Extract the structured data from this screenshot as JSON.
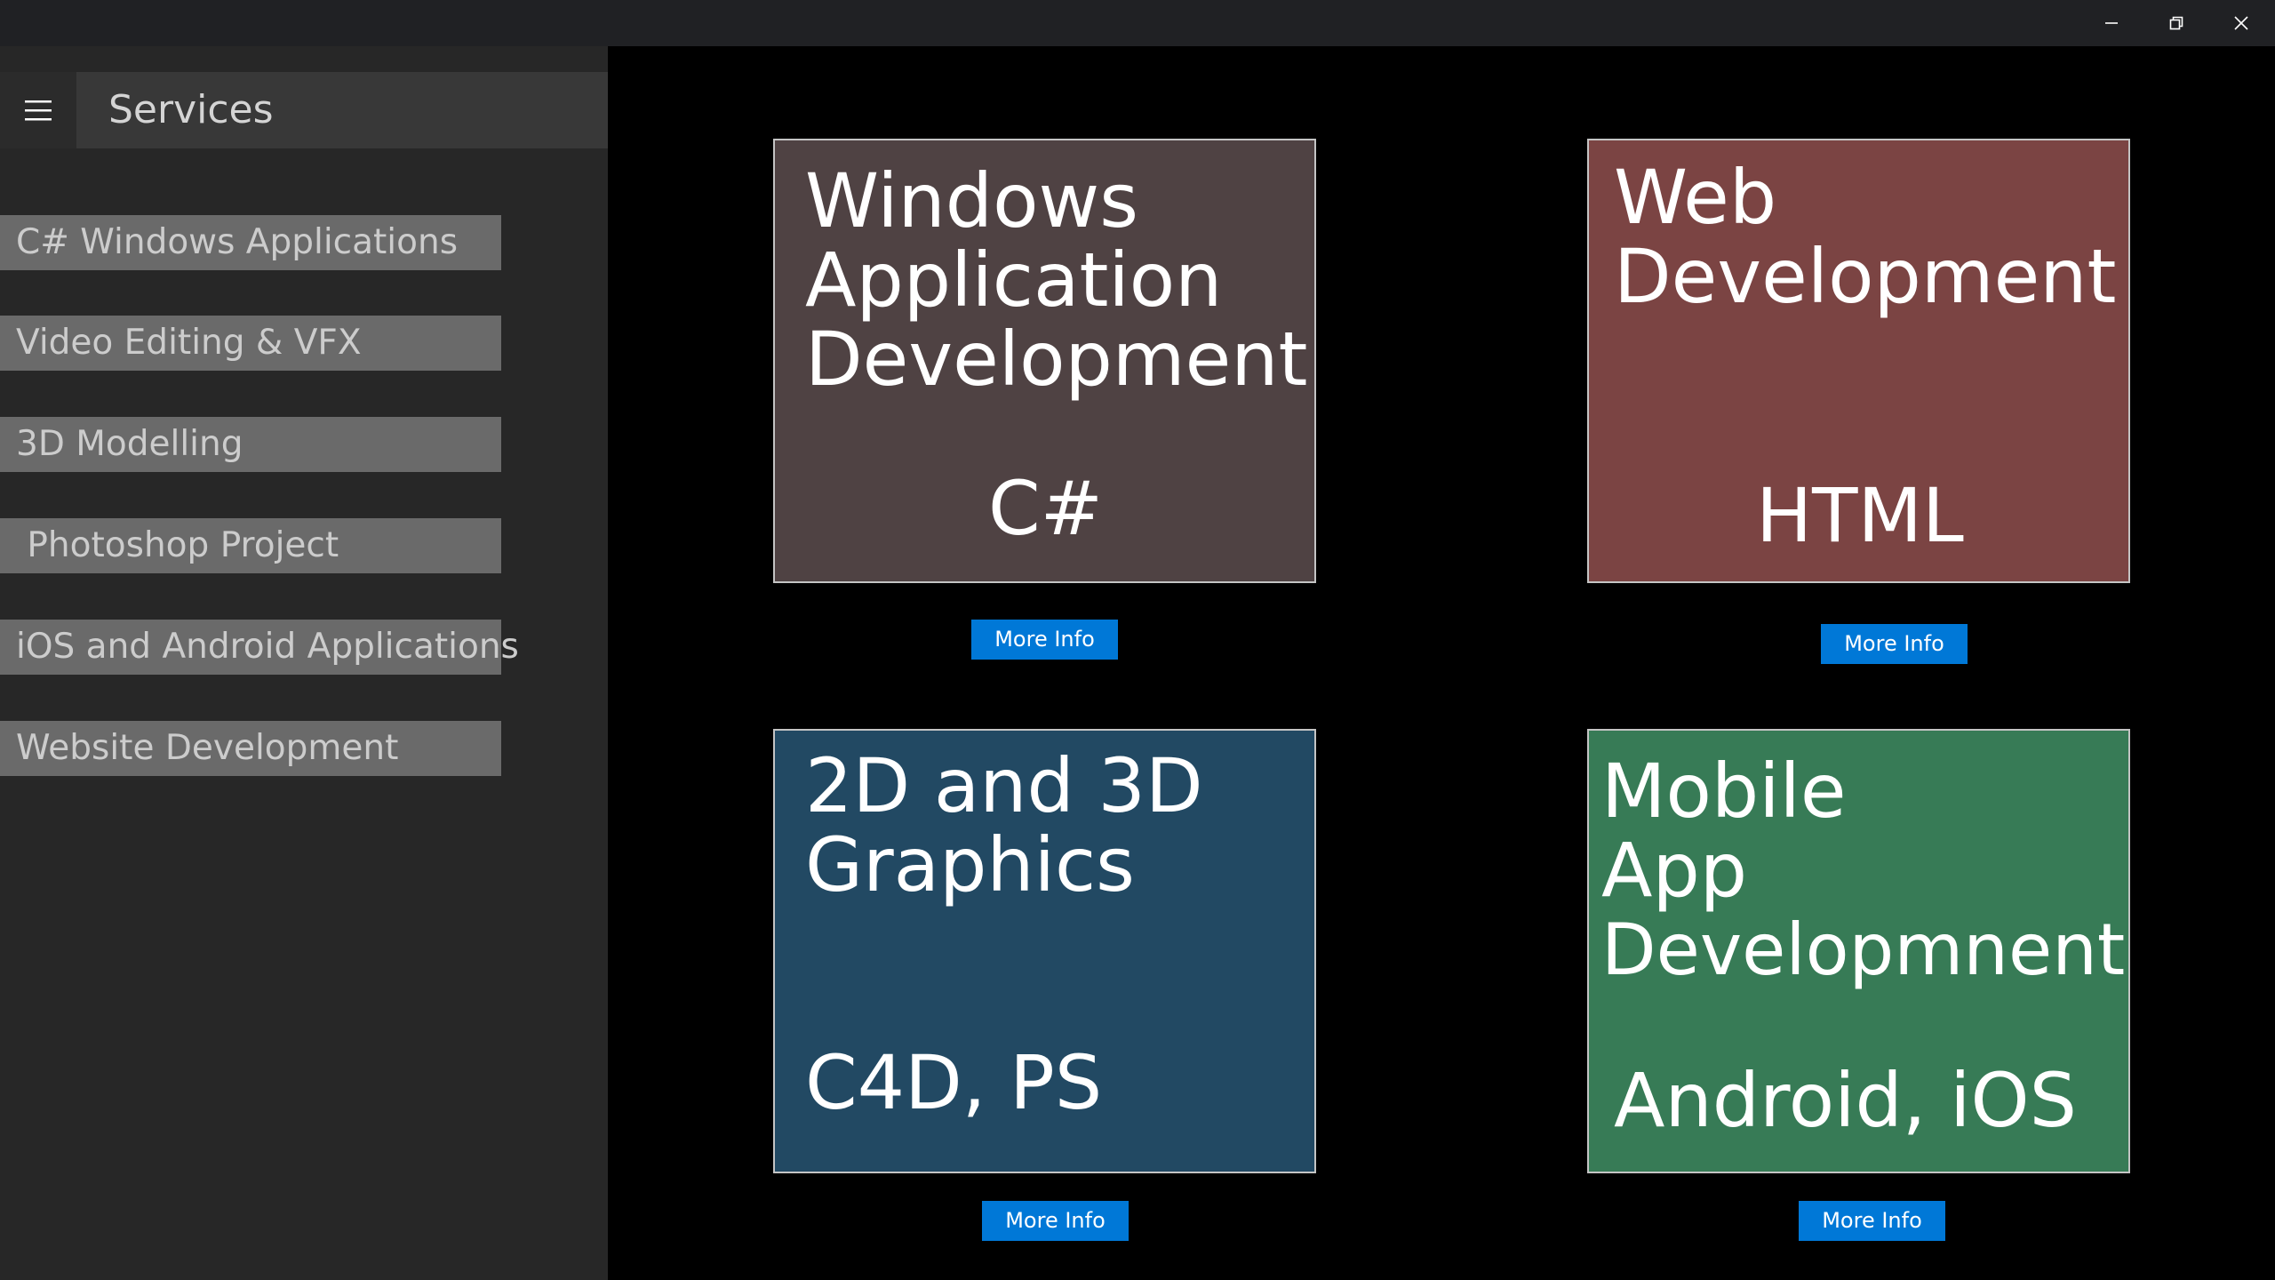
{
  "window": {
    "minimize_glyph": "─",
    "restore_glyph": "⧉",
    "close_glyph": "✕"
  },
  "sidebar": {
    "menu_icon": "hamburger-icon",
    "title": "Services",
    "items": [
      {
        "label": "C# Windows Applications"
      },
      {
        "label": "Video Editing & VFX"
      },
      {
        "label": "3D Modelling"
      },
      {
        "label": " Photoshop Project"
      },
      {
        "label": "iOS and Android Applications"
      },
      {
        "label": "Website Development"
      }
    ]
  },
  "tiles": [
    {
      "title_lines": [
        "Windows",
        "Application",
        "Development"
      ],
      "subtitle": "C#",
      "color": "#4f4243",
      "button": "More Info"
    },
    {
      "title_lines": [
        "Web",
        "Development"
      ],
      "subtitle": "HTML",
      "color": "#7b4443",
      "button": "More Info"
    },
    {
      "title_lines": [
        "2D and 3D",
        "Graphics"
      ],
      "subtitle": "C4D, PS",
      "color": "#224963",
      "button": "More Info"
    },
    {
      "title_lines": [
        "Mobile",
        "App",
        "Developmnent"
      ],
      "subtitle": "Android, iOS",
      "color": "#377b56",
      "button": "More Info"
    }
  ],
  "colors": {
    "accent": "#0078d7",
    "background": "#000000",
    "sidebar": "#272727"
  }
}
